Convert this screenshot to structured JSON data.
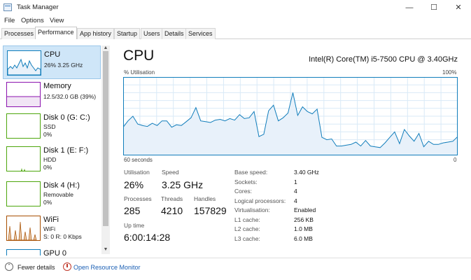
{
  "window": {
    "title": "Task Manager",
    "minimize": "—",
    "maximize": "☐",
    "close": "✕"
  },
  "menu": [
    "File",
    "Options",
    "View"
  ],
  "tabs": [
    "Processes",
    "Performance",
    "App history",
    "Startup",
    "Users",
    "Details",
    "Services"
  ],
  "sidebar": {
    "items": [
      {
        "title": "CPU",
        "line1": "26% 3.25 GHz",
        "line2": "",
        "color": "#117dbb",
        "selected": true
      },
      {
        "title": "Memory",
        "line1": "12.5/32.0 GB (39%)",
        "line2": "",
        "color": "#8b12ae"
      },
      {
        "title": "Disk 0 (G: C:)",
        "line1": "SSD",
        "line2": "0%",
        "color": "#4da60c"
      },
      {
        "title": "Disk 1 (E: F:)",
        "line1": "HDD",
        "line2": "0%",
        "color": "#4da60c"
      },
      {
        "title": "Disk 4 (H:)",
        "line1": "Removable",
        "line2": "0%",
        "color": "#4da60c"
      },
      {
        "title": "WiFi",
        "line1": "WiFi",
        "line2": "S: 0 R: 0 Kbps",
        "color": "#a74f01"
      },
      {
        "title": "GPU 0",
        "line1": "",
        "line2": "",
        "color": "#117dbb"
      }
    ]
  },
  "main": {
    "title": "CPU",
    "cpu_model": "Intel(R) Core(TM) i5-7500 CPU @ 3.40GHz",
    "graph": {
      "ylabel": "% Utilisation",
      "ymax_label": "100%",
      "xlabel_left": "60 seconds",
      "xlabel_right": "0",
      "values": [
        36,
        44,
        50,
        40,
        38,
        37,
        41,
        38,
        44,
        44,
        36,
        39,
        38,
        43,
        48,
        61,
        44,
        43,
        42,
        45,
        46,
        44,
        47,
        45,
        52,
        47,
        48,
        56,
        24,
        27,
        57,
        64,
        44,
        48,
        54,
        80,
        51,
        62,
        56,
        53,
        59,
        23,
        20,
        21,
        12,
        12,
        13,
        14,
        17,
        12,
        19,
        12,
        11,
        10,
        16,
        23,
        30,
        15,
        33,
        25,
        18,
        28,
        11,
        18,
        14,
        14,
        16,
        17,
        18,
        24
      ],
      "line_color": "#117dbb",
      "fill_color": "#e8f1fa"
    },
    "stats": {
      "utilisation_label": "Utilisation",
      "utilisation_value": "26%",
      "speed_label": "Speed",
      "speed_value": "3.25 GHz",
      "processes_label": "Processes",
      "processes_value": "285",
      "threads_label": "Threads",
      "threads_value": "4210",
      "handles_label": "Handles",
      "handles_value": "157829",
      "uptime_label": "Up time",
      "uptime_value": "6:00:14:28"
    },
    "details": [
      {
        "label": "Base speed:",
        "value": "3.40 GHz"
      },
      {
        "label": "Sockets:",
        "value": "1"
      },
      {
        "label": "Cores:",
        "value": "4"
      },
      {
        "label": "Logical processors:",
        "value": "4"
      },
      {
        "label": "Virtualisation:",
        "value": "Enabled"
      },
      {
        "label": "L1 cache:",
        "value": "256 KB"
      },
      {
        "label": "L2 cache:",
        "value": "1.0 MB"
      },
      {
        "label": "L3 cache:",
        "value": "6.0 MB"
      }
    ]
  },
  "footer": {
    "fewer_details": "Fewer details",
    "open_resource_monitor": "Open Resource Monitor"
  }
}
